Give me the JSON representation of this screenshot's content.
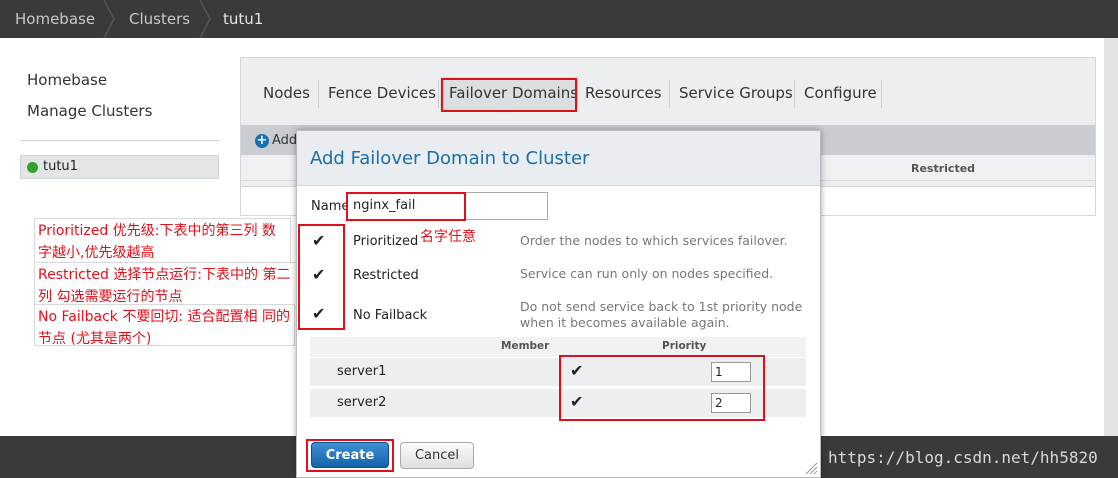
{
  "breadcrumb": [
    "Homebase",
    "Clusters",
    "tutu1"
  ],
  "sidebar": {
    "items": [
      "Homebase",
      "Manage Clusters"
    ],
    "cluster": {
      "name": "tutu1",
      "status_color": "#2fa22f"
    }
  },
  "tabs": [
    "Nodes",
    "Fence Devices",
    "Failover Domains",
    "Resources",
    "Service Groups",
    "Configure"
  ],
  "toolbar": {
    "add_label": "Add"
  },
  "table": {
    "restricted_header": "Restricted"
  },
  "modal": {
    "title": "Add Failover Domain to Cluster",
    "name_label": "Name",
    "name_value": "nginx_fail",
    "name_note": "名字任意",
    "options": [
      {
        "label": "Prioritized",
        "checked": true,
        "description": "Order the nodes to which services failover."
      },
      {
        "label": "Restricted",
        "checked": true,
        "description": "Service can run only on nodes specified."
      },
      {
        "label": "No Failback",
        "checked": true,
        "description": "Do not send service back to 1st priority node when it becomes available again."
      }
    ],
    "members_header": {
      "member": "Member",
      "priority": "Priority"
    },
    "members": [
      {
        "name": "server1",
        "checked": true,
        "priority": "1"
      },
      {
        "name": "server2",
        "checked": true,
        "priority": "2"
      }
    ],
    "create_label": "Create",
    "cancel_label": "Cancel"
  },
  "annotations": {
    "prioritized": "Prioritized 优先级:下表中的第三列 数字越小,优先级越高",
    "restricted": "Restricted  选择节点运行:下表中的 第二列 勾选需要运行的节点",
    "nofailback": "No Failback 不要回切: 适合配置相 同的节点 (尤其是两个)"
  },
  "watermark": "https://blog.csdn.net/hh5820",
  "colors": {
    "accent": "#1a6fa8",
    "annotation": "#e0101a",
    "header_bg": "#3a3a3a"
  }
}
